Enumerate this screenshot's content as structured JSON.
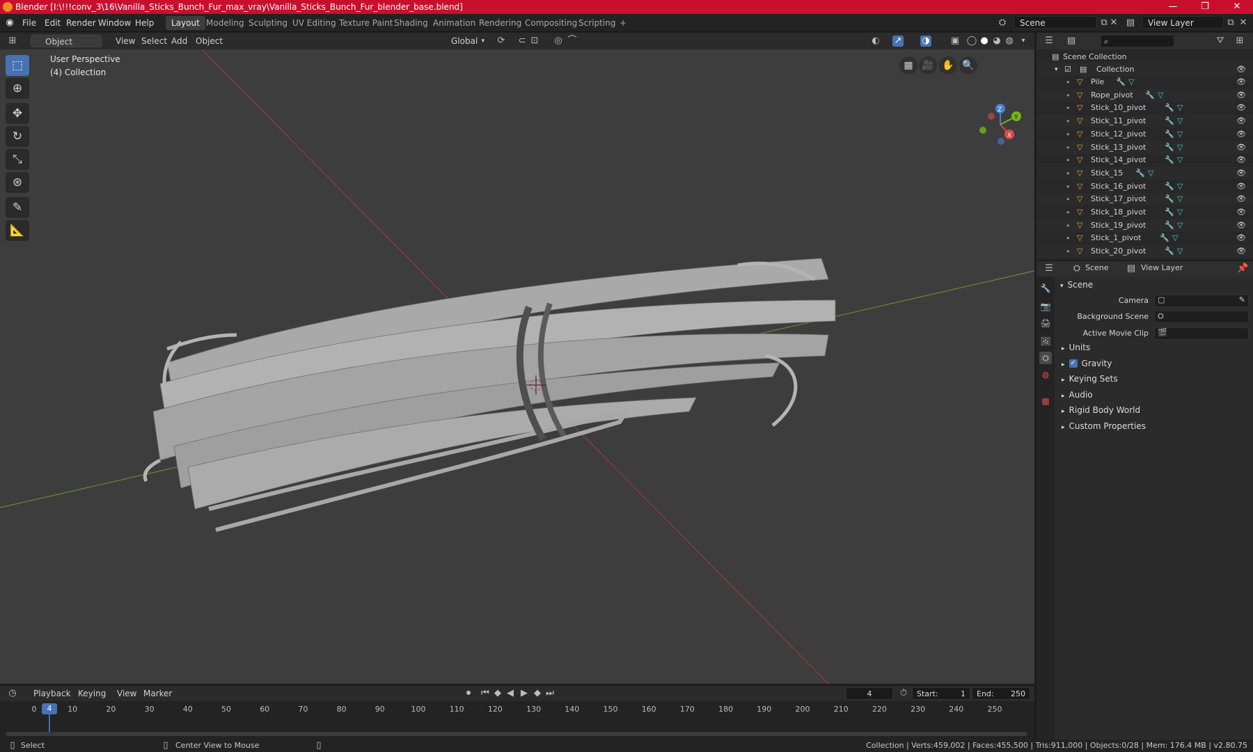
{
  "window": {
    "title": "Blender [I:\\!!!conv_3\\16\\Vanilla_Sticks_Bunch_Fur_max_vray\\Vanilla_Sticks_Bunch_Fur_blender_base.blend]",
    "minimize": "—",
    "maximize": "❐",
    "close": "✕"
  },
  "menus": [
    "File",
    "Edit",
    "Render",
    "Window",
    "Help"
  ],
  "workspaces": [
    "Layout",
    "Modeling",
    "Sculpting",
    "UV Editing",
    "Texture Paint",
    "Shading",
    "Animation",
    "Rendering",
    "Compositing",
    "Scripting"
  ],
  "workspace_add": "+",
  "top_right": {
    "scene_field": "Scene",
    "view_layer_field": "View Layer"
  },
  "viewport_header": {
    "mode": "Object Mode",
    "menus": [
      "View",
      "Select",
      "Add",
      "Object"
    ],
    "transform_orientation": "Global"
  },
  "viewport": {
    "perspective": "User Perspective",
    "collection": "(4) Collection",
    "gizmo": {
      "z": "Z",
      "y": "Y",
      "x": "X"
    }
  },
  "outliner": {
    "search_placeholder": "",
    "scene_collection": "Scene Collection",
    "collection": "Collection",
    "items": [
      "Pile",
      "Rope_pivot",
      "Stick_10_pivot",
      "Stick_11_pivot",
      "Stick_12_pivot",
      "Stick_13_pivot",
      "Stick_14_pivot",
      "Stick_15",
      "Stick_16_pivot",
      "Stick_17_pivot",
      "Stick_18_pivot",
      "Stick_19_pivot",
      "Stick_1_pivot",
      "Stick_20_pivot"
    ]
  },
  "properties": {
    "breadcrumb_scene": "Scene",
    "breadcrumb_view_layer": "View Layer",
    "panel_title": "Scene",
    "camera_label": "Camera",
    "background_scene_label": "Background Scene",
    "active_movie_clip_label": "Active Movie Clip",
    "sections": [
      "Units",
      "Gravity",
      "Keying Sets",
      "Audio",
      "Rigid Body World",
      "Custom Properties"
    ]
  },
  "timeline": {
    "menus": [
      "Playback",
      "Keying",
      "View",
      "Marker"
    ],
    "current_frame": "4",
    "start_label": "Start:",
    "start_value": "1",
    "end_label": "End:",
    "end_value": "250",
    "ticks": [
      "0",
      "10",
      "20",
      "30",
      "40",
      "50",
      "60",
      "70",
      "80",
      "90",
      "100",
      "110",
      "120",
      "130",
      "140",
      "150",
      "160",
      "170",
      "180",
      "190",
      "200",
      "210",
      "220",
      "230",
      "240",
      "250"
    ]
  },
  "statusbar": {
    "select": "Select",
    "center_view": "Center View to Mouse",
    "stats": "Collection | Verts:459,002 | Faces:455,500 | Tris:911,000 | Objects:0/28 | Mem: 176.4 MB | v2.80.75"
  },
  "colors": {
    "accent": "#4772b3",
    "title_bar": "#c8102e",
    "object_icon": "#f2a23a"
  }
}
